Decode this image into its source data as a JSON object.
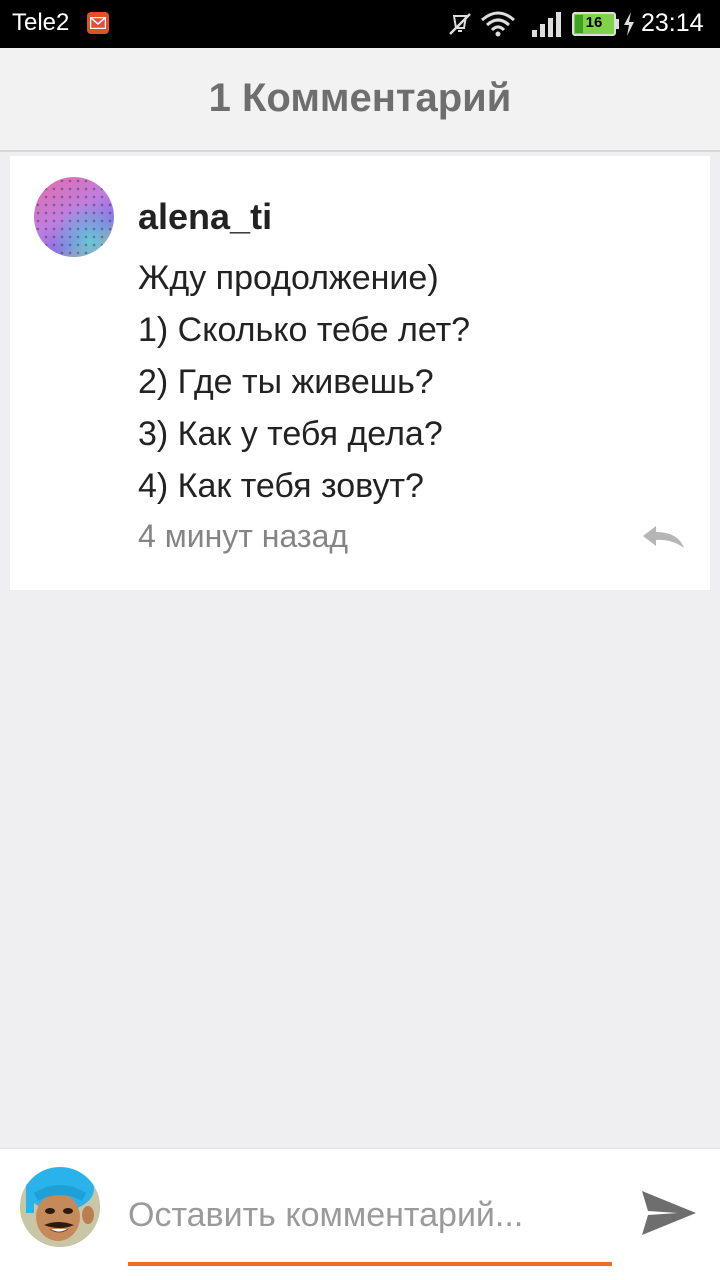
{
  "status_bar": {
    "carrier": "Tele2",
    "battery_level": "16",
    "time": "23:14"
  },
  "header": {
    "title": "1 Комментарий"
  },
  "comment": {
    "author": "alena_ti",
    "lines": [
      "Жду продолжение)",
      "1) Сколько тебе лет?",
      "2) Где ты живешь?",
      "3) Как у тебя дела?",
      "4) Как тебя зовут?"
    ],
    "time": "4 минут назад"
  },
  "compose": {
    "placeholder": "Оставить комментарий..."
  },
  "colors": {
    "accent": "#f26d21",
    "header_text": "#6e6e6e",
    "muted_text": "#858585"
  }
}
